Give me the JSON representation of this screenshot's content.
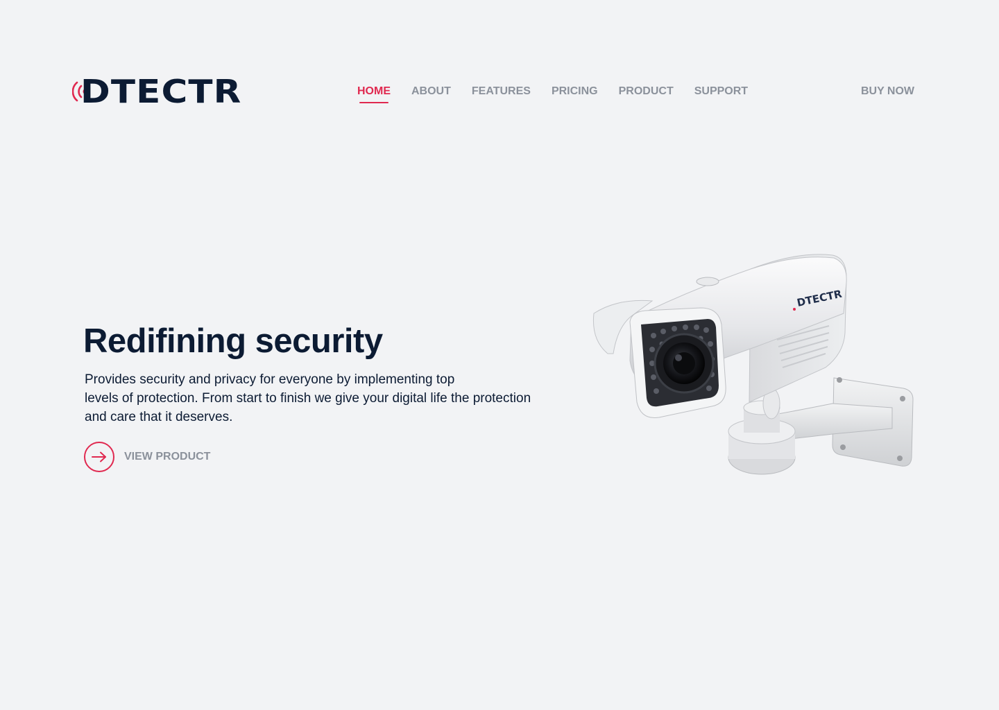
{
  "brand": {
    "name": "DTECTR",
    "accent_color": "#e0284f",
    "text_color": "#0c1b33"
  },
  "nav": {
    "items": [
      {
        "label": "HOME",
        "active": true
      },
      {
        "label": "ABOUT",
        "active": false
      },
      {
        "label": "FEATURES",
        "active": false
      },
      {
        "label": "PRICING",
        "active": false
      },
      {
        "label": "PRODUCT",
        "active": false
      },
      {
        "label": "SUPPORT",
        "active": false
      }
    ],
    "buy_label": "BUY NOW"
  },
  "hero": {
    "title": "Redifining security",
    "description_lines": [
      "Provides security and privacy for everyone by implementing top",
      "levels of protection. From start to finish we give your digital life the protection",
      "and care that it deserves."
    ],
    "cta_label": "VIEW PRODUCT",
    "cta_icon": "arrow-right-icon"
  },
  "product_image": {
    "subject": "security-camera",
    "label": "DTECTR"
  }
}
